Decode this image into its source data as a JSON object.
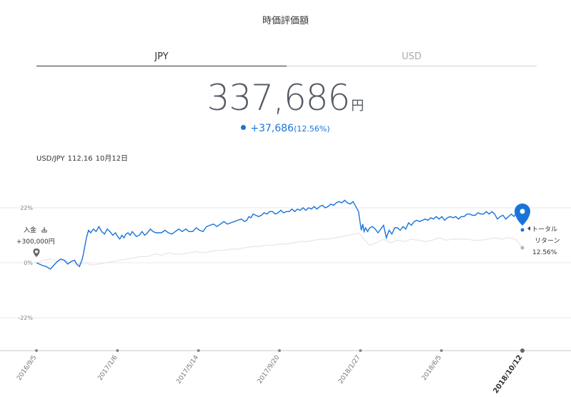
{
  "header": {
    "title": "時価評価額"
  },
  "tabs": [
    {
      "label": "JPY",
      "active": true
    },
    {
      "label": "USD",
      "active": false
    }
  ],
  "valuation": {
    "value": "337,686",
    "unit": "円",
    "change": "+37,686",
    "change_pct": "(12.56%)"
  },
  "fx": {
    "pair": "USD/JPY",
    "rate": "112.16",
    "date": "10月12日"
  },
  "colors": {
    "accent": "#1a73d9",
    "benchmark": "#e6e8ee",
    "grid": "#e8e8e8"
  },
  "chart_data": {
    "type": "line",
    "x_ticks": [
      "2016/9/5",
      "2017/1/6",
      "2017/5/14",
      "2017/9/20",
      "2018/1/27",
      "2018/6/5",
      "2018/10/12"
    ],
    "y_ticks": [
      "22%",
      "0%",
      "-22%"
    ],
    "ylim": [
      -35,
      28
    ],
    "series": [
      {
        "role": "portfolio",
        "color": "#1a73d9",
        "x": [
          0,
          4,
          8,
          14,
          20,
          25,
          30,
          35,
          40,
          45,
          50,
          55,
          58,
          62,
          66,
          68,
          70,
          72,
          75,
          78,
          82,
          86,
          90,
          94,
          98,
          102,
          106,
          110,
          114,
          117,
          120,
          123,
          126,
          129,
          132,
          135,
          138,
          141,
          144,
          148,
          152,
          156,
          160,
          164,
          168,
          172,
          176,
          180,
          185,
          190,
          195,
          200,
          205,
          210,
          215,
          220,
          225,
          230,
          235,
          240,
          245,
          250,
          255,
          260,
          265,
          270,
          275,
          280,
          285,
          290,
          295,
          300,
          303,
          306,
          309,
          312,
          316,
          320,
          324,
          328,
          332,
          336,
          340,
          344,
          348,
          352,
          356,
          360,
          364,
          368,
          372,
          376,
          380,
          384,
          388,
          392,
          396,
          400,
          404,
          408,
          412,
          416,
          420,
          424,
          428,
          432,
          436,
          440,
          444,
          448,
          452,
          456,
          460,
          464,
          466,
          468,
          470,
          472,
          474,
          477,
          480,
          484,
          488,
          492,
          496,
          500,
          504,
          508,
          512,
          516,
          520,
          524,
          528,
          532,
          536,
          540,
          544,
          548,
          552,
          556,
          560,
          564,
          568,
          572,
          576,
          580,
          584,
          588,
          592,
          596,
          600,
          604,
          608,
          612,
          616,
          620,
          624,
          628,
          632,
          636,
          640,
          644,
          648,
          652,
          656,
          660,
          664,
          668,
          672,
          676,
          680,
          684,
          688,
          692,
          696,
          700
        ],
        "values": [
          0,
          -0.5,
          -1,
          -1.5,
          -2.5,
          -1,
          0.5,
          1.5,
          1,
          -0.5,
          0.5,
          1,
          -0.5,
          -1.5,
          1.5,
          4,
          7,
          10,
          13,
          12,
          13.5,
          12.5,
          14.5,
          12.5,
          11.5,
          13.5,
          12.5,
          11,
          12,
          10.5,
          9.5,
          11,
          10,
          11.5,
          12,
          11,
          12.5,
          11.5,
          10.5,
          11,
          12.5,
          11,
          12,
          13.5,
          12.5,
          12,
          12,
          12,
          13,
          12,
          11.5,
          12.5,
          13.5,
          12.5,
          13.5,
          12.5,
          12.5,
          14,
          13,
          12.5,
          14.5,
          15,
          15.5,
          14.5,
          15.5,
          16.5,
          15.5,
          16,
          16.5,
          17,
          17.5,
          16.5,
          17,
          18.5,
          18,
          19.5,
          19,
          18.5,
          19,
          20,
          19.5,
          20.5,
          20.5,
          19.5,
          20,
          21,
          20,
          20.5,
          20.5,
          21.5,
          20.5,
          21.5,
          21,
          22,
          21,
          22,
          21.5,
          22.5,
          21.5,
          22.5,
          23,
          22,
          22.5,
          23.5,
          23,
          24,
          24.5,
          24,
          25,
          24,
          23.5,
          24.5,
          22.5,
          20.5,
          16.5,
          13,
          15.5,
          12.5,
          14,
          12.5,
          14,
          14.5,
          13.5,
          12,
          13.5,
          15,
          10,
          13,
          11.5,
          14,
          14,
          13,
          14.5,
          13.5,
          16,
          15,
          16.5,
          17,
          16.5,
          17,
          17.5,
          17,
          18,
          17.5,
          18.5,
          17.5,
          18.5,
          17,
          18,
          18.5,
          18,
          18.5,
          17.5,
          18.5,
          18.5,
          19.5,
          19.5,
          19,
          19,
          20,
          19.5,
          19.5,
          20.5,
          19.5,
          20.5,
          19.5,
          17.5,
          18.5,
          19,
          17.5,
          18.5,
          19.5,
          18.5,
          20.5,
          20.5,
          21.5
        ]
      },
      {
        "role": "benchmark",
        "color": "#e6e8ee",
        "x": [
          0,
          10,
          20,
          30,
          40,
          50,
          60,
          70,
          80,
          90,
          100,
          110,
          120,
          130,
          140,
          150,
          160,
          170,
          180,
          190,
          200,
          210,
          220,
          230,
          240,
          250,
          260,
          270,
          280,
          290,
          300,
          310,
          320,
          330,
          340,
          350,
          360,
          370,
          380,
          390,
          400,
          410,
          420,
          430,
          440,
          450,
          460,
          465,
          470,
          475,
          480,
          490,
          500,
          510,
          520,
          530,
          540,
          550,
          560,
          570,
          580,
          590,
          600,
          610,
          620,
          630,
          640,
          650,
          660,
          670,
          680,
          690,
          700
        ],
        "values": [
          0,
          1,
          1.5,
          0.5,
          1,
          0,
          -0.5,
          0,
          -1,
          -0.5,
          0,
          0.5,
          1,
          1.5,
          2,
          2.5,
          2.5,
          3.5,
          3,
          4,
          3.5,
          3.5,
          4,
          4.5,
          4,
          4.5,
          5,
          5,
          5.5,
          5.5,
          6,
          6.5,
          6.5,
          7,
          7,
          7.5,
          7.5,
          8,
          8.5,
          8.5,
          9,
          9.5,
          9.5,
          10,
          10.5,
          11,
          11.5,
          12,
          10,
          8.5,
          7,
          8,
          9.5,
          8,
          9,
          8.5,
          9.5,
          9,
          8.5,
          9,
          10,
          9,
          9.5,
          9.5,
          9.5,
          9,
          9,
          9.5,
          10,
          9.5,
          10,
          9.5,
          6
        ]
      }
    ],
    "annotations": {
      "deposit_label": "入金",
      "deposit_amount": "+300,000円",
      "total_return_label_1": "トータル",
      "total_return_label_2": "リターン",
      "total_return_value": "12.56%"
    }
  }
}
